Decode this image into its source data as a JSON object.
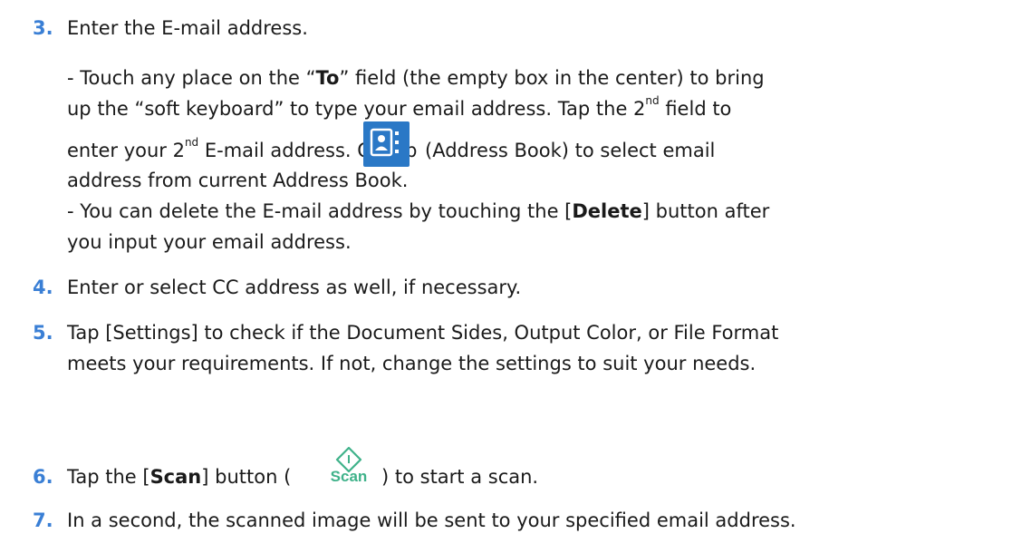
{
  "steps": [
    {
      "num": "3.",
      "title": "Enter the E-mail address.",
      "para1_a": "- Touch any place on the “",
      "para1_b": "To",
      "para1_c": "” field (the empty box in the center) to bring",
      "para1_line2_a": "up the “soft keyboard” to type your email address.   Tap the 2",
      "para1_line2_sup": "nd",
      "para1_line2_b": " field to",
      "para1_line3_a": "enter your 2",
      "para1_line3_sup": "nd",
      "para1_line3_b": " E-mail address.   Or tap",
      "para1_line3_c": "(Address Book) to select email",
      "para1_line4": "address from current Address Book.",
      "para2_a": "- You can delete the E-mail address by touching the [",
      "para2_b": "Delete",
      "para2_c": "] button after",
      "para2_line2": "you input your email address."
    },
    {
      "num": "4.",
      "title": "Enter or select CC address as well, if necessary."
    },
    {
      "num": "5.",
      "line1": "Tap [Settings] to check if the Document Sides, Output Color, or File Format",
      "line2": "meets your requirements.   If not, change the settings to suit your needs."
    },
    {
      "num": "6.",
      "a": "Tap the [",
      "b": "Scan",
      "c": "] button (",
      "d": ") to start a scan.",
      "icon_label": "Scan"
    },
    {
      "num": "7.",
      "title": "In a second, the scanned image will be sent to your specified email address."
    }
  ],
  "icons": {
    "address_book": "address-book-icon",
    "scan": "scan-diamond-icon",
    "address_book_color": "#2a78c6",
    "scan_color": "#3fb28a",
    "step_number_color": "#3a7fd5"
  }
}
